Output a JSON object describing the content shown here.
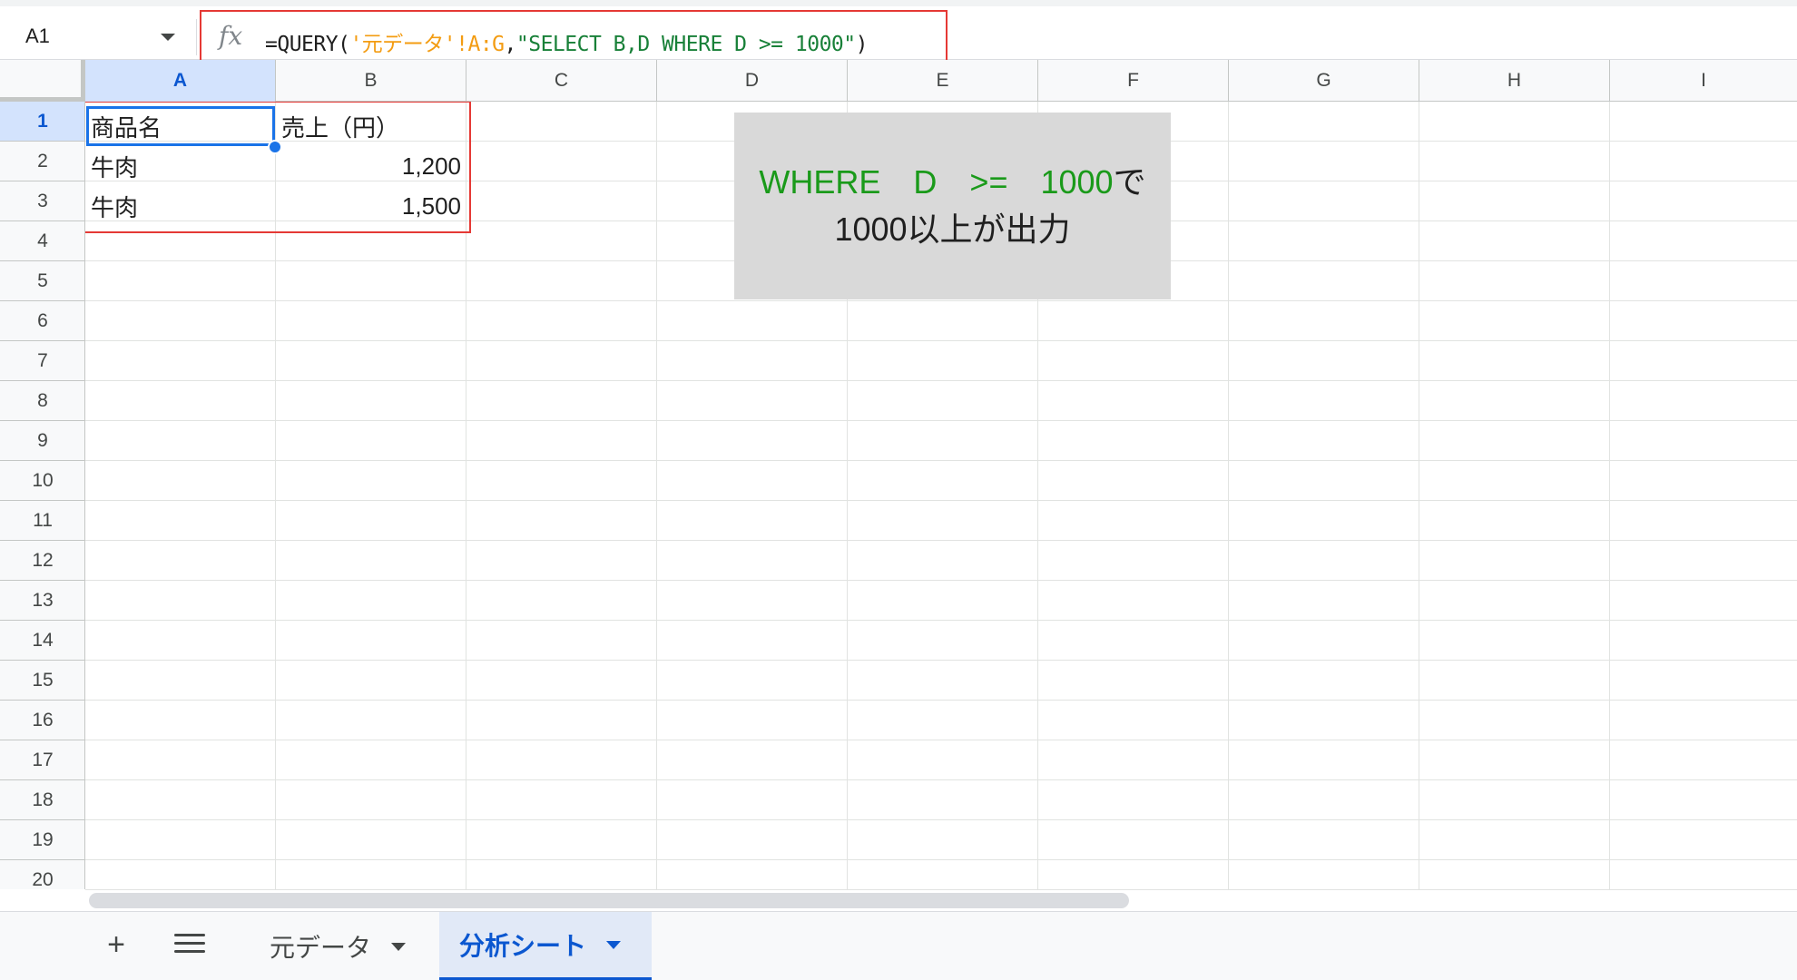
{
  "formula_bar": {
    "cell_ref": "A1",
    "fx": "fx",
    "formula_parts": [
      {
        "text": "=QUERY(",
        "color": "dark"
      },
      {
        "text": "'元データ'!A:G",
        "color": "orange"
      },
      {
        "text": ",",
        "color": "dark"
      },
      {
        "text": "\"SELECT B,D WHERE D >= 1000\"",
        "color": "green"
      },
      {
        "text": ")",
        "color": "dark"
      }
    ]
  },
  "columns": [
    "A",
    "B",
    "C",
    "D",
    "E",
    "F",
    "G",
    "H",
    "I"
  ],
  "active_column": "A",
  "rows": [
    "1",
    "2",
    "3",
    "4",
    "5",
    "6",
    "7",
    "8",
    "9",
    "10",
    "11",
    "12",
    "13",
    "14",
    "15",
    "16",
    "17",
    "18",
    "19",
    "20"
  ],
  "active_row": "1",
  "cells": {
    "A1": "商品名",
    "B1": "売上（円）",
    "A2": "牛肉",
    "B2": "1,200",
    "A3": "牛肉",
    "B3": "1,500"
  },
  "callout": {
    "line1_green": "WHERE　D　>=　1000",
    "line1_black": "で",
    "line2": "1000以上が出力"
  },
  "tabs": {
    "add_label": "+",
    "sheets": [
      {
        "name": "元データ",
        "active": false
      },
      {
        "name": "分析シート",
        "active": true
      }
    ]
  },
  "colors": {
    "accent": "#0b57d0",
    "highlight_box": "#e53935",
    "formula_string": "#188038",
    "formula_range": "#f39c12"
  }
}
